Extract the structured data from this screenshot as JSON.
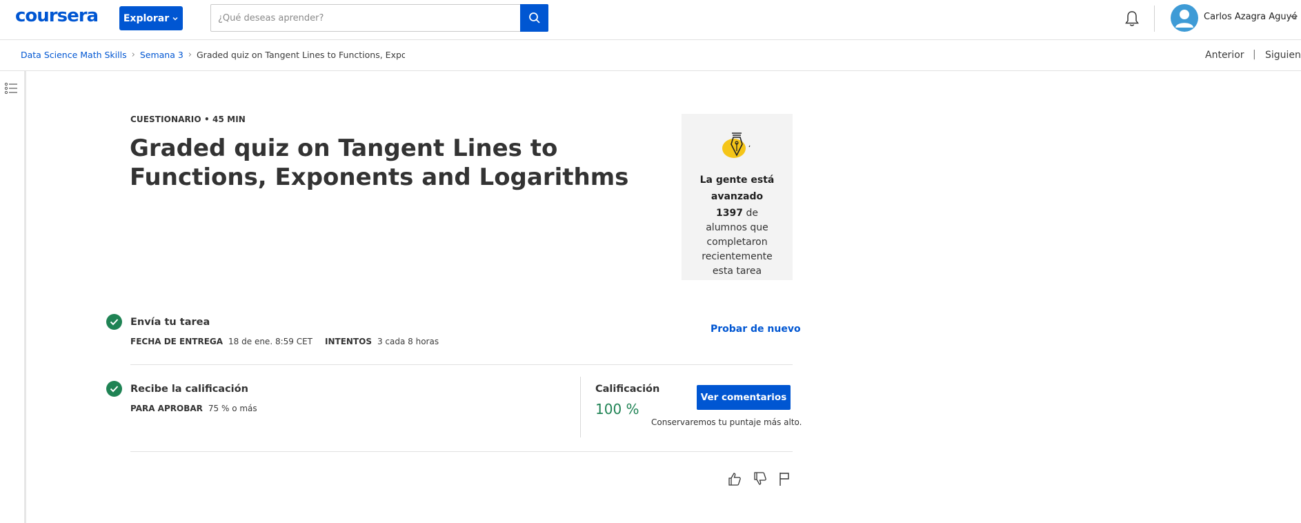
{
  "header": {
    "logo": "coursera",
    "explore_label": "Explorar",
    "search_placeholder": "¿Qué deseas aprender?",
    "user_name": "Carlos Azagra Aguyé"
  },
  "breadcrumb": {
    "items": [
      "Data Science Math Skills",
      "Semana 3",
      "Graded quiz on Tangent Lines to Functions, Exponents and Logarithms"
    ]
  },
  "nav": {
    "previous": "Anterior",
    "separator": "|",
    "next": "Siguiente"
  },
  "assignment": {
    "eyebrow": "CUESTIONARIO • 45 MIN",
    "title": "Graded quiz on Tangent Lines to Functions, Exponents and Logarithms"
  },
  "progress_card": {
    "heading": "La gente está avanzado",
    "count": "1397",
    "text": "de alumnos que completaron recientemente esta tarea"
  },
  "submit": {
    "heading": "Envía tu tarea",
    "due_label": "FECHA DE ENTREGA",
    "due_value": "18 de ene. 8:59 CET",
    "attempts_label": "INTENTOS",
    "attempts_value": "3 cada 8 horas",
    "try_again": "Probar de nuevo"
  },
  "grade": {
    "heading": "Recibe la calificación",
    "pass_label": "PARA APROBAR",
    "pass_value": "75 % o más",
    "grade_label": "Calificación",
    "grade_value": "100 %",
    "feedback_button": "Ver comentarios",
    "note": "Conservaremos tu puntaje más alto."
  },
  "colors": {
    "brand": "#0056d2",
    "success": "#1f8354",
    "card_bg": "#f3f3f3",
    "illustration_yellow": "#f5c518"
  },
  "icons": [
    "search-icon",
    "bell-icon",
    "avatar-icon",
    "chevron-down-icon",
    "menu-list-icon",
    "pen-nib-icon",
    "check-icon",
    "thumbs-up-icon",
    "thumbs-down-icon",
    "flag-icon"
  ]
}
